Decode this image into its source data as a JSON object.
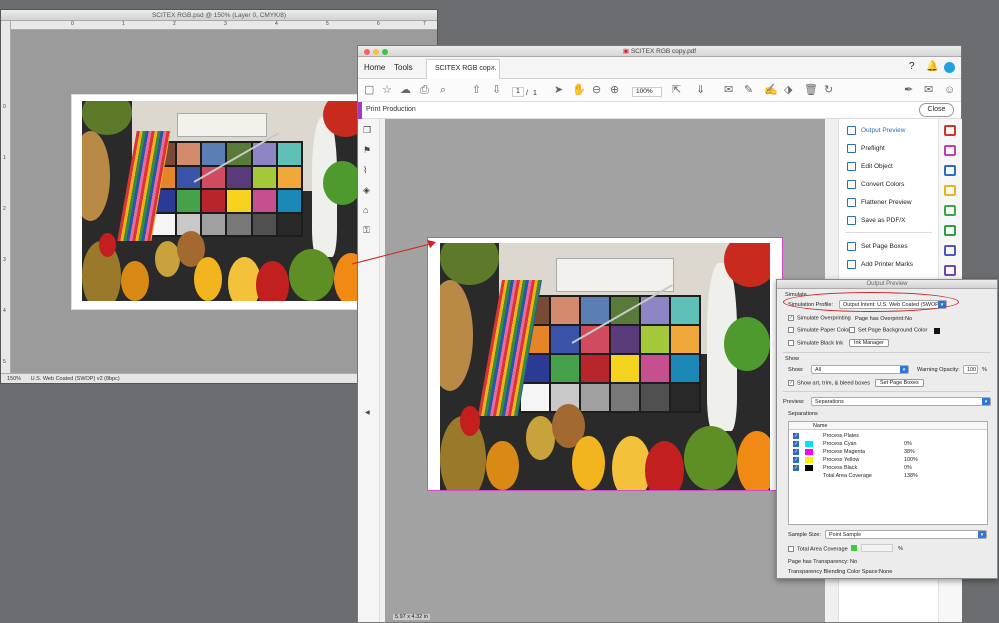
{
  "photoshop": {
    "title": "SCITEX RGB.psd @ 150% (Layer 0, CMYK/8)",
    "ruler_h": [
      "0",
      "1",
      "2",
      "3",
      "4",
      "5",
      "6",
      "7"
    ],
    "ruler_v": [
      "0",
      "1",
      "2",
      "3",
      "4",
      "5"
    ],
    "zoom": "150%",
    "profile": "U.S. Web Coated (SWOP) v2 (8bpc)"
  },
  "acrobat": {
    "title": "SCITEX RGB copy.pdf",
    "menu": {
      "home": "Home",
      "tools": "Tools",
      "tab_label": "SCITEX RGB cop...",
      "tab_close": "×"
    },
    "toolbar": {
      "page_current": "1",
      "page_sep": "/",
      "page_total": "1",
      "zoom": "100%"
    },
    "subbar": {
      "title": "Print Production",
      "close": "Close"
    },
    "right_panel": [
      "Output Preview",
      "Preflight",
      "Edit Object",
      "Convert Colors",
      "Flattener Preview",
      "Save as PDF/X",
      "Set Page Boxes",
      "Add Printer Marks"
    ],
    "page_size": "5.97 x 4.32 in",
    "colors": {
      "accent": "#9b3fc0",
      "blue": "#2a6ebb"
    }
  },
  "output_preview": {
    "title": "Output Preview",
    "simulate_heading": "Simulate",
    "sim_profile_label": "Simulation Profile:",
    "sim_profile_value": "Output Intent: U.S. Web Coated (SWOP)...",
    "simulate_overprinting": "Simulate Overprinting",
    "page_has_overprint": "Page has Overprint:",
    "page_has_overprint_value": "No",
    "simulate_paper_color": "Simulate Paper Color",
    "set_page_bg": "Set Page Background Color",
    "simulate_black_ink": "Simulate Black Ink",
    "ink_manager": "Ink Manager",
    "show_heading": "Show",
    "show_label": "Show:",
    "show_value": "All",
    "warning_opacity_label": "Warning Opacity:",
    "warning_opacity_value": "100",
    "percent": "%",
    "show_art_trim": "Show art, trim, & bleed boxes",
    "set_page_boxes": "Set Page Boxes",
    "preview_label": "Preview:",
    "preview_value": "Separations",
    "separations_heading": "Separations",
    "name_col": "Name",
    "separations": [
      {
        "name": "Process Plates",
        "value": "",
        "color": ""
      },
      {
        "name": "Process Cyan",
        "value": "0%",
        "color": "#00e5ff"
      },
      {
        "name": "Process Magenta",
        "value": "38%",
        "color": "#ff00ff"
      },
      {
        "name": "Process Yellow",
        "value": "100%",
        "color": "#ffee00"
      },
      {
        "name": "Process Black",
        "value": "0%",
        "color": "#000000"
      },
      {
        "name": "Total Area Coverage",
        "value": "138%",
        "color": ""
      }
    ],
    "sample_size_label": "Sample Size:",
    "sample_size_value": "Point Sample",
    "total_area_coverage": "Total Area Coverage",
    "page_has_transparency": "Page has Transparency:",
    "page_has_transparency_value": "No",
    "blending_space": "Transparency Blending Color Space:",
    "blending_space_value": "None"
  }
}
